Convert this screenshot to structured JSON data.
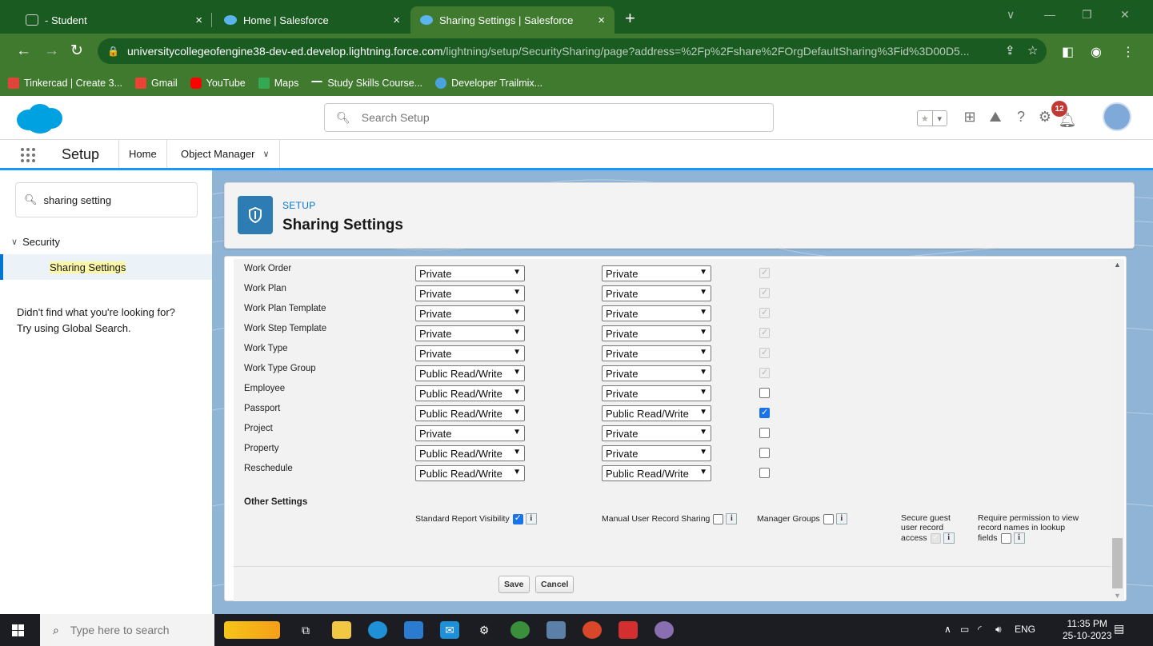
{
  "browser": {
    "tabs": [
      {
        "title": "- Student",
        "active": false
      },
      {
        "title": "Home | Salesforce",
        "active": false
      },
      {
        "title": "Sharing Settings | Salesforce",
        "active": true
      }
    ],
    "tab_close": "×",
    "new_tab": "+",
    "window_controls": {
      "minimize": "—",
      "restore": "❐",
      "close": "✕",
      "profile_menu": "∨"
    },
    "url_host": "universitycollegeofengine38-dev-ed.develop.lightning.force.com",
    "url_path": "/lightning/setup/SecuritySharing/page?address=%2Fp%2Fshare%2FOrgDefaultSharing%3Fid%3D00D5...",
    "bookmarks": [
      {
        "label": "Tinkercad | Create 3...",
        "color": "#e1453a"
      },
      {
        "label": "Gmail",
        "color": "#ea4335"
      },
      {
        "label": "YouTube",
        "color": "#ff0000"
      },
      {
        "label": "Maps",
        "color": "#34a853"
      },
      {
        "label": "Study Skills Course...",
        "color": "#3f7a2e"
      },
      {
        "label": "Developer Trailmix...",
        "color": "#4aa3df"
      }
    ]
  },
  "header": {
    "search_placeholder": "Search Setup",
    "notification_count": "12"
  },
  "nav": {
    "app_name": "Setup",
    "tabs": [
      {
        "label": "Home"
      },
      {
        "label": "Object Manager"
      }
    ]
  },
  "sidebar": {
    "quick_find_value": "sharing setting",
    "group": "Security",
    "active_item": "Sharing Settings",
    "help_line1": "Didn't find what you're looking for?",
    "help_line2": "Try using Global Search."
  },
  "page": {
    "eyebrow": "SETUP",
    "title": "Sharing Settings"
  },
  "sharing_rows": [
    {
      "object": "Work Order",
      "internal": "Private",
      "external": "Private",
      "grant": "disabled"
    },
    {
      "object": "Work Plan",
      "internal": "Private",
      "external": "Private",
      "grant": "disabled"
    },
    {
      "object": "Work Plan Template",
      "internal": "Private",
      "external": "Private",
      "grant": "disabled"
    },
    {
      "object": "Work Step Template",
      "internal": "Private",
      "external": "Private",
      "grant": "disabled"
    },
    {
      "object": "Work Type",
      "internal": "Private",
      "external": "Private",
      "grant": "disabled"
    },
    {
      "object": "Work Type Group",
      "internal": "Public Read/Write",
      "external": "Private",
      "grant": "disabled"
    },
    {
      "object": "Employee",
      "internal": "Public Read/Write",
      "external": "Private",
      "grant": "unchecked"
    },
    {
      "object": "Passport",
      "internal": "Public Read/Write",
      "external": "Public Read/Write",
      "grant": "checked"
    },
    {
      "object": "Project",
      "internal": "Private",
      "external": "Private",
      "grant": "unchecked"
    },
    {
      "object": "Property",
      "internal": "Public Read/Write",
      "external": "Private",
      "grant": "unchecked"
    },
    {
      "object": "Reschedule",
      "internal": "Public Read/Write",
      "external": "Public Read/Write",
      "grant": "unchecked"
    }
  ],
  "other_settings": {
    "heading": "Other Settings",
    "standard_report_visibility": "Standard Report Visibility",
    "manual_user_record_sharing": "Manual User Record Sharing",
    "manager_groups": "Manager Groups",
    "secure_guest_line1": "Secure guest",
    "secure_guest_line2": "user record",
    "secure_guest_line3": "access",
    "require_permission_line1": "Require permission to view",
    "require_permission_line2": "record names in lookup",
    "require_permission_line3": "fields",
    "info_glyph": "i"
  },
  "buttons": {
    "save": "Save",
    "cancel": "Cancel"
  },
  "taskbar": {
    "search_placeholder": "Type here to search",
    "language": "ENG",
    "time": "11:35 PM",
    "date": "25-10-2023"
  },
  "colors": {
    "chrome_dark": "#1a5b21",
    "chrome_light": "#3f7a2e",
    "salesforce_blue": "#00a1e0",
    "brand_accent": "#0176d3"
  }
}
